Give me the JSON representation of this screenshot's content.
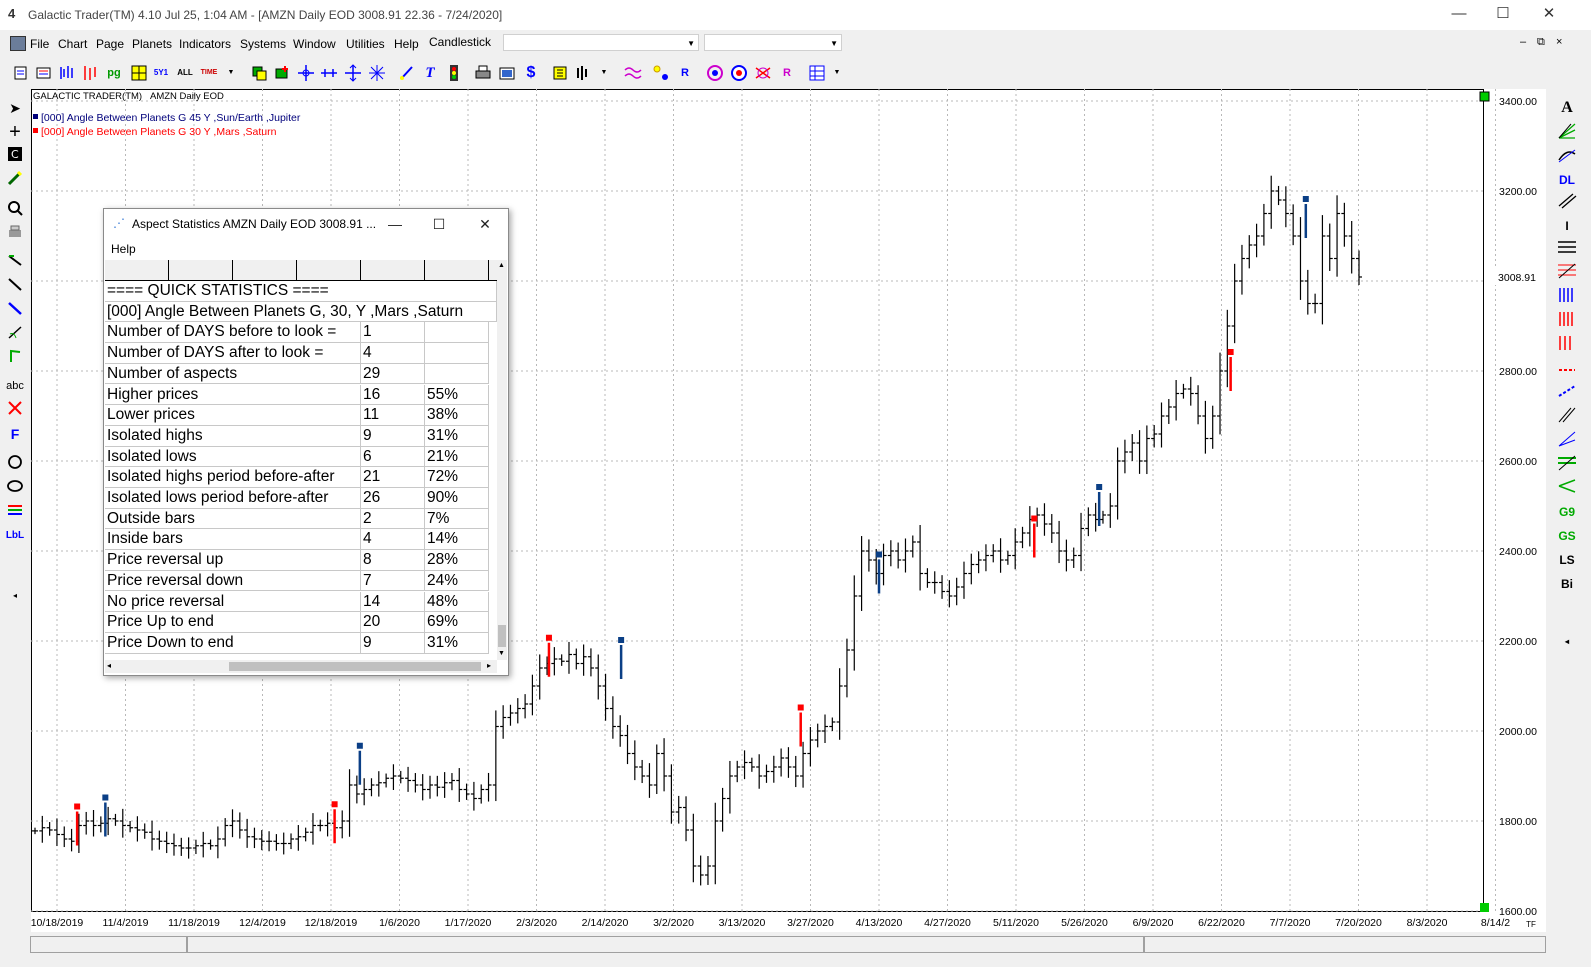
{
  "window": {
    "title": "Galactic Trader(TM) 4.10 Jul 25,  1:04 AM - [AMZN Daily EOD  3008.91     22.36 - 7/24/2020]",
    "app_icon": "4",
    "minimize": "—",
    "maximize": "☐",
    "close": "✕"
  },
  "menu": {
    "items": [
      "File",
      "Chart",
      "Page",
      "Planets",
      "Indicators",
      "Systems",
      "Window",
      "Utilities",
      "Help"
    ],
    "chart_type": "Candlestick",
    "combo2": "",
    "combo3": "",
    "mdi_min": "–",
    "mdi_restore": "⧉",
    "mdi_close": "×"
  },
  "toolbar": {
    "icons": [
      "new-chart-icon",
      "open-icon",
      "bars-icon",
      "candles-icon",
      "pg-icon",
      "grid-icon",
      "5y1-icon",
      "all-icon",
      "time-icon",
      "dropdown-icon",
      "layers-icon",
      "add-layer-icon",
      "crosshair-icon",
      "arrows-icon",
      "star-icon",
      "pen-icon",
      "text-icon",
      "traffic-icon",
      "print-icon",
      "preview-icon",
      "dollar-icon",
      "flag-icon",
      "bars2-icon",
      "waves-icon",
      "stars-icon",
      "r-icon",
      "target-icon",
      "wheel-icon",
      "aspect-icon",
      "r2-icon",
      "table-icon"
    ],
    "labels": {
      "pg": "pg",
      "5y1": "5Y1",
      "all": "ALL",
      "time": "TIME",
      "dollar": "$"
    }
  },
  "left_tools": {
    "abc": "abc",
    "f": "F",
    "lbl": "LbL"
  },
  "right_tools": {
    "labels": [
      "A",
      "",
      "",
      "DL",
      "",
      "I",
      "",
      "",
      "",
      "",
      "",
      "",
      "",
      "",
      "",
      "",
      "",
      "G9",
      "GS",
      "LS",
      "Bi"
    ]
  },
  "chart": {
    "header_left": "GALACTIC TRADER(TM)",
    "header_right": "AMZN Daily EOD",
    "legend": [
      {
        "text": "[000] Angle Between Planets G 45 Y ,Sun/Earth ,Jupiter",
        "color": "#00007b"
      },
      {
        "text": "[000] Angle Between Planets G 30 Y ,Mars ,Saturn",
        "color": "#ff0000"
      }
    ],
    "last_price_label": "3008.91",
    "corner_label": "TF"
  },
  "chart_data": {
    "type": "ohlc",
    "x_ticks": [
      "10/18/2019",
      "11/4/2019",
      "11/18/2019",
      "12/4/2019",
      "12/18/2019",
      "1/6/2020",
      "1/17/2020",
      "2/3/2020",
      "2/14/2020",
      "3/2/2020",
      "3/13/2020",
      "3/27/2020",
      "4/13/2020",
      "4/27/2020",
      "5/11/2020",
      "5/26/2020",
      "6/9/2020",
      "6/22/2020",
      "7/7/2020",
      "7/20/2020",
      "8/3/2020",
      "8/14/2"
    ],
    "y_ticks": [
      "1600.00",
      "1800.00",
      "2000.00",
      "2200.00",
      "2400.00",
      "2600.00",
      "2800.00",
      "3000.00",
      "3200.00",
      "3400.00"
    ],
    "ylim": [
      1600,
      3420
    ],
    "last_price": 3008.91,
    "grid": true,
    "closes": [
      1778,
      1785,
      1780,
      1770,
      1760,
      1755,
      1790,
      1800,
      1790,
      1795,
      1805,
      1800,
      1790,
      1785,
      1780,
      1775,
      1760,
      1755,
      1750,
      1745,
      1740,
      1740,
      1745,
      1750,
      1745,
      1760,
      1790,
      1800,
      1780,
      1765,
      1760,
      1755,
      1755,
      1750,
      1750,
      1760,
      1765,
      1775,
      1790,
      1790,
      1795,
      1785,
      1800,
      1880,
      1860,
      1870,
      1880,
      1885,
      1895,
      1900,
      1895,
      1890,
      1880,
      1870,
      1880,
      1875,
      1885,
      1890,
      1870,
      1860,
      1850,
      1870,
      1880,
      2010,
      2030,
      2040,
      2050,
      2060,
      2100,
      2140,
      2150,
      2160,
      2155,
      2170,
      2150,
      2165,
      2140,
      2100,
      2050,
      2010,
      1990,
      1950,
      1920,
      1900,
      1880,
      1950,
      1900,
      1820,
      1830,
      1780,
      1700,
      1680,
      1700,
      1800,
      1850,
      1900,
      1920,
      1930,
      1920,
      1900,
      1910,
      1920,
      1940,
      1920,
      1900,
      1950,
      1980,
      2000,
      2010,
      2020,
      2100,
      2180,
      2300,
      2400,
      2380,
      2350,
      2390,
      2400,
      2380,
      2400,
      2420,
      2350,
      2330,
      2330,
      2310,
      2300,
      2320,
      2350,
      2370,
      2380,
      2390,
      2400,
      2380,
      2390,
      2420,
      2440,
      2470,
      2480,
      2460,
      2440,
      2400,
      2380,
      2390,
      2450,
      2480,
      2470,
      2480,
      2500,
      2600,
      2620,
      2640,
      2600,
      2650,
      2660,
      2700,
      2720,
      2750,
      2760,
      2750,
      2700,
      2650,
      2700,
      2800,
      2900,
      3000,
      3050,
      3080,
      3100,
      3150,
      3200,
      3180,
      3150,
      3100,
      3000,
      2950,
      2950,
      3100,
      3050,
      3150,
      3100,
      3050,
      3008.91
    ],
    "markers_red": [
      [
        "10/23/2019",
        1790
      ],
      [
        "12/19/2019",
        1795
      ],
      [
        "2/5/2020",
        2165
      ],
      [
        "3/25/2020",
        2010
      ],
      [
        "5/15/2020",
        2430
      ],
      [
        "6/24/2020",
        2800
      ]
    ],
    "markers_blue": [
      [
        "10/30/2019",
        1810
      ],
      [
        "12/26/2019",
        1925
      ],
      [
        "2/18/2020",
        2160
      ],
      [
        "4/13/2020",
        2350
      ],
      [
        "5/29/2020",
        2500
      ],
      [
        "7/10/2020",
        3140
      ]
    ]
  },
  "dialog": {
    "title": "Aspect Statistics AMZN Daily EOD  3008.91   ...",
    "menu": "Help",
    "rows": [
      [
        "==== QUICK STATISTICS ====",
        "",
        ""
      ],
      [
        "[000] Angle Between Planets G, 30, Y ,Mars ,Saturn",
        "",
        ""
      ],
      [
        "Number of DAYS before to look =",
        "1",
        ""
      ],
      [
        "Number of DAYS after to look =",
        "4",
        ""
      ],
      [
        "Number of aspects",
        "29",
        ""
      ],
      [
        "Higher prices",
        "16",
        "55%"
      ],
      [
        "Lower prices",
        "11",
        "38%"
      ],
      [
        "Isolated highs",
        "9",
        "31%"
      ],
      [
        "Isolated lows",
        "6",
        "21%"
      ],
      [
        "Isolated highs period before-after",
        "21",
        "72%"
      ],
      [
        "Isolated lows period before-after",
        "26",
        "90%"
      ],
      [
        "Outside bars",
        "2",
        "7%"
      ],
      [
        "Inside bars",
        "4",
        "14%"
      ],
      [
        "Price reversal up",
        "8",
        "28%"
      ],
      [
        "Price reversal down",
        "7",
        "24%"
      ],
      [
        "No price reversal",
        "14",
        "48%"
      ],
      [
        "Price Up to end",
        "20",
        "69%"
      ],
      [
        "Price Down to end",
        "9",
        "31%"
      ]
    ]
  }
}
